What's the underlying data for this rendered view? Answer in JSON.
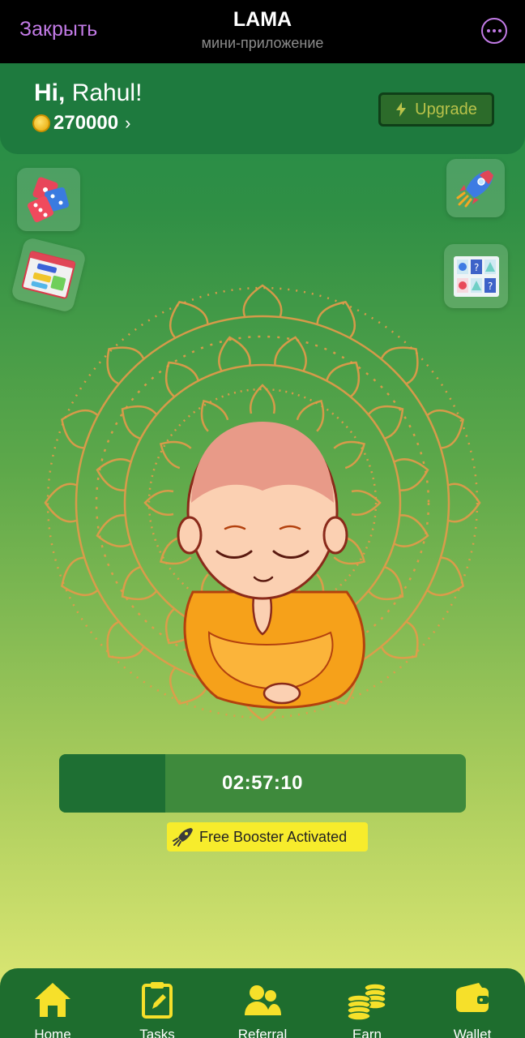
{
  "topbar": {
    "close_label": "Закрыть",
    "title": "LAMA",
    "subtitle": "мини-приложение",
    "more_icon": "more-horizontal-icon"
  },
  "header": {
    "greeting_prefix": "Hi,",
    "greeting_name": "Rahul!",
    "balance": "270000",
    "upgrade_label": "Upgrade"
  },
  "side_tiles": {
    "left": [
      "dice-icon",
      "login-icon"
    ],
    "right": [
      "rocket-icon",
      "puzzle-icon"
    ]
  },
  "timer": {
    "value": "02:57:10",
    "progress": 0.26
  },
  "booster": {
    "label": "Free Booster Activated"
  },
  "nav": {
    "items": [
      {
        "label": "Home",
        "icon": "home-icon"
      },
      {
        "label": "Tasks",
        "icon": "tasks-icon"
      },
      {
        "label": "Referral",
        "icon": "referral-icon"
      },
      {
        "label": "Earn",
        "icon": "coins-icon"
      },
      {
        "label": "Wallet",
        "icon": "wallet-icon"
      }
    ]
  },
  "colors": {
    "accent_purple": "#c27be6",
    "nav_icon": "#f6e02a",
    "booster_bg": "#f7ec2c"
  }
}
